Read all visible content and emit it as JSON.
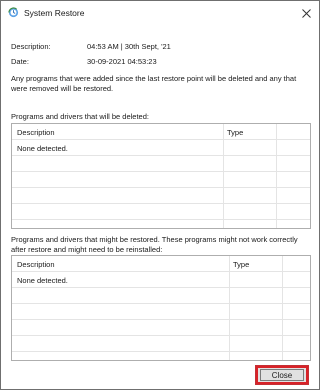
{
  "window": {
    "title": "System Restore",
    "icon": "system-restore-icon",
    "close_glyph": "✕"
  },
  "info": {
    "description_label": "Description:",
    "description_value": "04:53 AM | 30th Sept, '21",
    "date_label": "Date:",
    "date_value": "30-09-2021 04:53:23",
    "notice": "Any programs that were added since the last restore point will be deleted and any that were removed will be restored."
  },
  "deleted_section": {
    "label": "Programs and drivers that will be deleted:",
    "columns": [
      "Description",
      "Type"
    ],
    "rows": [
      {
        "description": "None detected.",
        "type": ""
      }
    ]
  },
  "restored_section": {
    "label": "Programs and drivers that might be restored. These programs might not work correctly after restore and might need to be reinstalled:",
    "columns": [
      "Description",
      "Type"
    ],
    "rows": [
      {
        "description": "None detected.",
        "type": ""
      }
    ]
  },
  "footer": {
    "close_label": "Close"
  },
  "colors": {
    "highlight_border": "#d82228",
    "button_face": "#e1e1e1",
    "grid_border": "#aeaeae",
    "grid_lines": "#e4e4e4"
  }
}
